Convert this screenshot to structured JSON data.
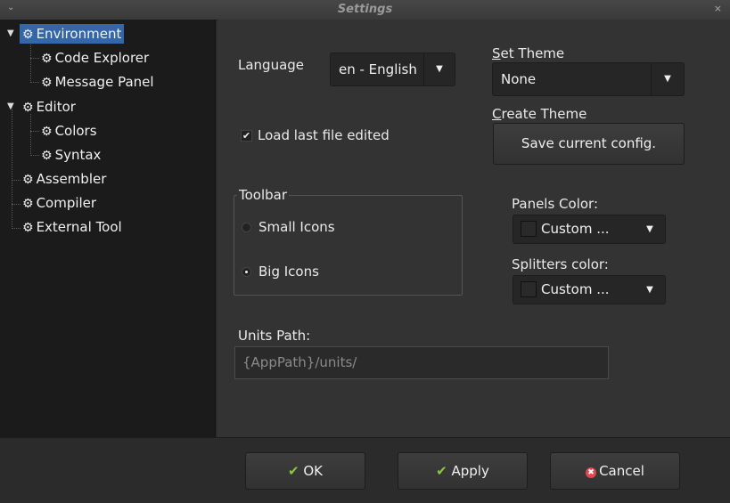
{
  "window": {
    "title": "Settings",
    "menu_icon": "chevron-down-icon",
    "close_icon": "close-icon"
  },
  "tree": {
    "items": [
      {
        "label": "Environment",
        "expanded": true,
        "selected": true
      },
      {
        "label": "Code Explorer"
      },
      {
        "label": "Message Panel"
      },
      {
        "label": "Editor",
        "expanded": true
      },
      {
        "label": "Colors"
      },
      {
        "label": "Syntax"
      },
      {
        "label": "Assembler"
      },
      {
        "label": "Compiler"
      },
      {
        "label": "External Tool"
      }
    ]
  },
  "panel": {
    "language_label": "Language",
    "language_value": "en - English",
    "set_theme_label_first": "S",
    "set_theme_label_rest": "et Theme",
    "set_theme_value": "None",
    "create_theme_label_first": "C",
    "create_theme_label_rest": "reate Theme",
    "save_config_label": "Save current config.",
    "load_last_file_label": "Load last file edited",
    "load_last_file_checked": true,
    "toolbar_label": "Toolbar",
    "small_icons_label": "Small Icons",
    "big_icons_label": "Big Icons",
    "toolbar_selected": "Big Icons",
    "panels_color_label": "Panels Color:",
    "panels_color_value": "Custom ...",
    "splitters_color_label": "Splitters color:",
    "splitters_color_value": "Custom ...",
    "units_path_label": "Units Path:",
    "units_path_placeholder": "{AppPath}/units/"
  },
  "buttons": {
    "ok": "OK",
    "apply": "Apply",
    "cancel": "Cancel"
  },
  "colors": {
    "selection": "#3367a7",
    "ok_check": "#8dc63f",
    "cancel_red": "#e2474b"
  }
}
